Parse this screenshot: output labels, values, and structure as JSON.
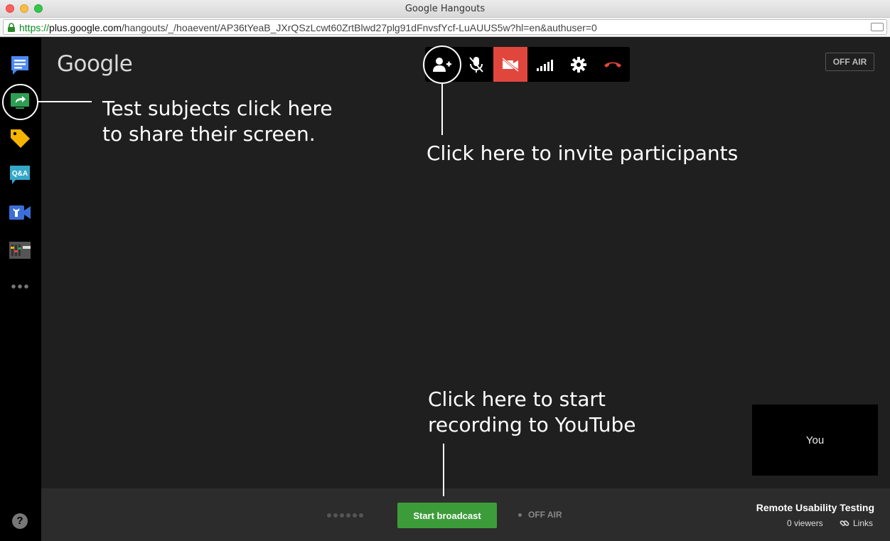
{
  "window": {
    "title": "Google Hangouts"
  },
  "address_bar": {
    "scheme": "https://",
    "host": "plus.google.com",
    "path": "/hangouts/_/hoaevent/AP36tYeaB_JXrQSzLcwt60ZrtBlwd27plg91dFnvsfYcf-LuAUUS5w?hl=en&authuser=0"
  },
  "sidebar": {
    "apps": [
      {
        "name": "chat",
        "icon": "chat-icon"
      },
      {
        "name": "screenshare",
        "icon": "screenshare-icon"
      },
      {
        "name": "showcase",
        "icon": "tag-icon"
      },
      {
        "name": "qa",
        "icon": "qa-icon",
        "label": "Q&A"
      },
      {
        "name": "control-room",
        "icon": "camera-wrench-icon"
      },
      {
        "name": "cameraman",
        "icon": "mixer-icon"
      },
      {
        "name": "more",
        "icon": "more-icon"
      }
    ],
    "help_label": "?"
  },
  "header": {
    "logo": "Google",
    "status": "OFF AIR"
  },
  "toolbar": {
    "buttons": [
      "invite-icon",
      "mic-muted-icon",
      "camera-off-icon",
      "signal-icon",
      "settings-icon",
      "hangup-icon"
    ],
    "camera_off_color": "#e1463d",
    "hangup_color": "#e1463d"
  },
  "annotations": {
    "share": [
      "Test subjects click here",
      "to share their screen."
    ],
    "invite": "Click here to invite participants",
    "record": [
      "Click here to start",
      "recording to YouTube"
    ]
  },
  "self_view": {
    "label": "You"
  },
  "footer": {
    "broadcast_label": "Start broadcast",
    "broadcast_color": "#3d9c3a",
    "status": "OFF AIR",
    "event_title": "Remote Usability Testing",
    "viewers": "0 viewers",
    "links_label": "Links"
  }
}
